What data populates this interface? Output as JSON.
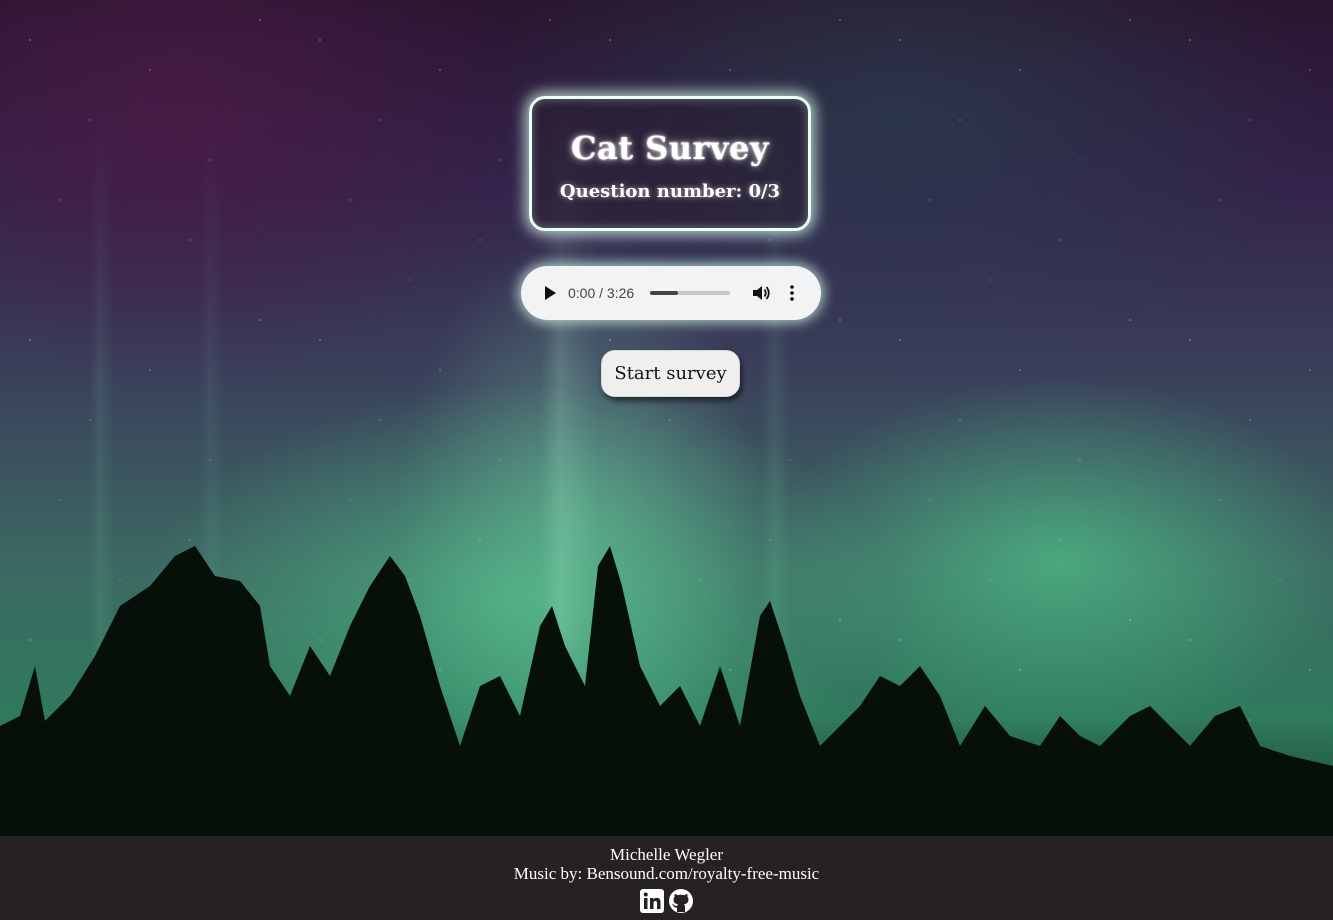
{
  "title_card": {
    "title": "Cat Survey",
    "question_number": "Question number: 0/3"
  },
  "audio": {
    "time": "0:00 / 3:26",
    "played_fraction": 0.35,
    "play_icon": "play-icon",
    "volume_icon": "volume-icon",
    "menu_icon": "more-options-icon"
  },
  "start_button": {
    "label": "Start survey"
  },
  "footer": {
    "author": "Michelle Wegler",
    "credit": "Music by: Bensound.com/royalty-free-music",
    "icons": [
      "linkedin-icon",
      "github-icon"
    ]
  },
  "colors": {
    "footer_bg": "#262223",
    "card_border": "#eafff4",
    "button_bg": "#efefef",
    "player_bg": "#f1f3f4"
  }
}
